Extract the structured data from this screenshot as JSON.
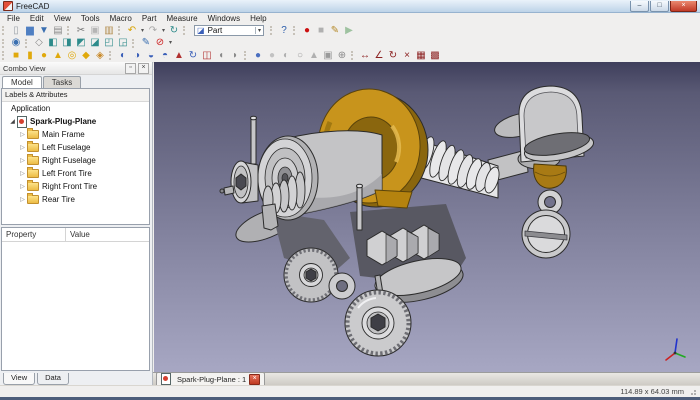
{
  "window": {
    "title": "FreeCAD",
    "buttons": [
      {
        "name": "minimize",
        "glyph": "–"
      },
      {
        "name": "maximize",
        "glyph": "□"
      },
      {
        "name": "close",
        "glyph": "×"
      }
    ]
  },
  "menu": {
    "items": [
      "File",
      "Edit",
      "View",
      "Tools",
      "Macro",
      "Part",
      "Measure",
      "Windows",
      "Help"
    ]
  },
  "toolbars": {
    "standard": {
      "groups": [
        {
          "name": "file",
          "icons": [
            {
              "name": "new-document",
              "glyph": "▯",
              "color": "#9aa0a8"
            },
            {
              "name": "open-document",
              "glyph": "▆",
              "color": "#4f7fc2"
            },
            {
              "name": "save-document",
              "glyph": "▼",
              "color": "#3a6fb0"
            },
            {
              "name": "print",
              "glyph": "▤",
              "color": "#8a8a8a"
            }
          ]
        },
        {
          "name": "edit",
          "icons": [
            {
              "name": "cut",
              "glyph": "✂",
              "color": "#777777"
            },
            {
              "name": "copy",
              "glyph": "▣",
              "color": "#b5b5b5"
            },
            {
              "name": "paste",
              "glyph": "▥",
              "color": "#b08a4a"
            }
          ]
        },
        {
          "name": "undo-redo",
          "icons": [
            {
              "name": "undo",
              "glyph": "↶",
              "color": "#d8a200"
            },
            {
              "name": "undo-dropdown",
              "glyph": "▾",
              "color": "#555555",
              "caret": true
            },
            {
              "name": "redo",
              "glyph": "↷",
              "color": "#a8a8a8"
            },
            {
              "name": "redo-dropdown",
              "glyph": "▾",
              "color": "#555555",
              "caret": true
            },
            {
              "name": "refresh",
              "glyph": "↻",
              "color": "#2e8b8b"
            }
          ]
        },
        {
          "name": "help",
          "icons": [
            {
              "name": "whats-this",
              "glyph": "?",
              "color": "#2a5caa"
            }
          ]
        },
        {
          "name": "macro",
          "icons": [
            {
              "name": "macro-record",
              "glyph": "●",
              "color": "#cc1111"
            },
            {
              "name": "macro-stop",
              "glyph": "■",
              "color": "#b0b0b0"
            },
            {
              "name": "macro-edit",
              "glyph": "✎",
              "color": "#b58a2a"
            },
            {
              "name": "macro-play",
              "glyph": "▶",
              "color": "#9ec2a0"
            }
          ]
        }
      ],
      "workbench_selector": {
        "value": "Part",
        "cube_glyph": "◪",
        "cube_color": "#3a5fb8",
        "caret": "▾"
      }
    },
    "view": {
      "groups": [
        {
          "name": "view-fit",
          "icons": [
            {
              "name": "fit-all",
              "glyph": "◉",
              "color": "#3a6fb0"
            }
          ]
        },
        {
          "name": "view-standard",
          "icons": [
            {
              "name": "view-axonometric",
              "glyph": "◇",
              "color": "#8a8a8a"
            },
            {
              "name": "view-front",
              "glyph": "◧",
              "color": "#2e8b8b"
            },
            {
              "name": "view-top",
              "glyph": "◨",
              "color": "#2e8b8b"
            },
            {
              "name": "view-right",
              "glyph": "◩",
              "color": "#2e8b8b"
            },
            {
              "name": "view-rear",
              "glyph": "◪",
              "color": "#2e8b8b"
            },
            {
              "name": "view-bottom",
              "glyph": "◰",
              "color": "#2e8b8b"
            },
            {
              "name": "view-left",
              "glyph": "◲",
              "color": "#2e8b8b"
            }
          ]
        },
        {
          "name": "view-extra",
          "icons": [
            {
              "name": "draw-style",
              "glyph": "✎",
              "color": "#3a6fb0"
            },
            {
              "name": "clipping-plane",
              "glyph": "⊘",
              "color": "#cc2222"
            },
            {
              "name": "clipping-dropdown",
              "glyph": "▾",
              "color": "#555555",
              "caret": true
            }
          ]
        }
      ]
    },
    "part": {
      "groups": [
        {
          "name": "primitives",
          "icons": [
            {
              "name": "part-box",
              "glyph": "■",
              "color": "#e0a90c"
            },
            {
              "name": "part-cylinder",
              "glyph": "▮",
              "color": "#e0a90c"
            },
            {
              "name": "part-sphere",
              "glyph": "●",
              "color": "#e0a90c"
            },
            {
              "name": "part-cone",
              "glyph": "▲",
              "color": "#e0a90c"
            },
            {
              "name": "part-torus",
              "glyph": "◎",
              "color": "#e0a90c"
            },
            {
              "name": "part-create-primitives",
              "glyph": "◆",
              "color": "#e0a90c"
            },
            {
              "name": "shape-builder",
              "glyph": "◈",
              "color": "#c98a2a"
            }
          ]
        },
        {
          "name": "booleans",
          "icons": [
            {
              "name": "boolean-operation",
              "glyph": "◐",
              "color": "#3a5fb8"
            },
            {
              "name": "boolean-cut",
              "glyph": "◑",
              "color": "#3a5fb8"
            },
            {
              "name": "boolean-union",
              "glyph": "◒",
              "color": "#3a5fb8"
            },
            {
              "name": "boolean-common",
              "glyph": "◓",
              "color": "#3a5fb8"
            },
            {
              "name": "extrude",
              "glyph": "▲",
              "color": "#b03030"
            },
            {
              "name": "revolve",
              "glyph": "↻",
              "color": "#3a5fb8"
            },
            {
              "name": "mirror",
              "glyph": "◫",
              "color": "#b03030"
            },
            {
              "name": "fillet",
              "glyph": "◖",
              "color": "#8a8a8a"
            },
            {
              "name": "chamfer",
              "glyph": "◗",
              "color": "#8a8a8a"
            }
          ]
        },
        {
          "name": "surfaces",
          "icons": [
            {
              "name": "loft",
              "glyph": "●",
              "color": "#4a6fc0"
            },
            {
              "name": "sweep",
              "glyph": "●",
              "color": "#c2c2c2"
            },
            {
              "name": "offset-surface",
              "glyph": "◐",
              "color": "#b0b0b0"
            },
            {
              "name": "thickness",
              "glyph": "○",
              "color": "#a0a0a0"
            },
            {
              "name": "shape-info",
              "glyph": "▲",
              "color": "#b0b0b0"
            },
            {
              "name": "refine-shape",
              "glyph": "▣",
              "color": "#9a9a9a"
            },
            {
              "name": "defeaturing",
              "glyph": "⊕",
              "color": "#8a8a8a"
            }
          ]
        },
        {
          "name": "measure",
          "icons": [
            {
              "name": "measure-linear",
              "glyph": "↔",
              "color": "#8b2020"
            },
            {
              "name": "measure-angular",
              "glyph": "∠",
              "color": "#8b2020"
            },
            {
              "name": "measure-refresh",
              "glyph": "↻",
              "color": "#8b2020"
            },
            {
              "name": "measure-clear-all",
              "glyph": "×",
              "color": "#8b2020"
            },
            {
              "name": "measure-toggle-all",
              "glyph": "▦",
              "color": "#8b2020"
            },
            {
              "name": "measure-toggle-delta",
              "glyph": "▩",
              "color": "#8b2020"
            }
          ]
        }
      ]
    }
  },
  "combo_view": {
    "title": "Combo View",
    "tabs": [
      {
        "label": "Model",
        "active": true
      },
      {
        "label": "Tasks",
        "active": false
      }
    ],
    "labels_header": "Labels & Attributes",
    "tree": {
      "root": "Application",
      "document": "Spark-Plug-Plane",
      "children": [
        "Main Frame",
        "Left Fuselage",
        "Right Fuselage",
        "Left Front Tire",
        "Right Front Tire",
        "Rear Tire"
      ]
    }
  },
  "property_panel": {
    "columns": [
      "Property",
      "Value"
    ]
  },
  "panel_bottom_tabs": [
    {
      "label": "View",
      "active": true
    },
    {
      "label": "Data",
      "active": false
    }
  ],
  "document_tab": {
    "label": "Spark-Plug-Plane : 1"
  },
  "status_bar": {
    "dimensions": "114.89 x 64.03 mm"
  },
  "viewport": {
    "model_name": "Spark-Plug-Plane",
    "background_top": "#3f3f5c",
    "background_mid1": "#5a5a75",
    "background_mid2": "#82829e",
    "background_bottom": "#a7a7c3",
    "colors": {
      "gold": "#c8941c",
      "gold_dark": "#8a660e",
      "silver": "#c9c9cb",
      "outline": "#2b2b2b",
      "axis_x": "#cc2222",
      "axis_y": "#22aa22",
      "axis_z": "#2233cc"
    }
  }
}
